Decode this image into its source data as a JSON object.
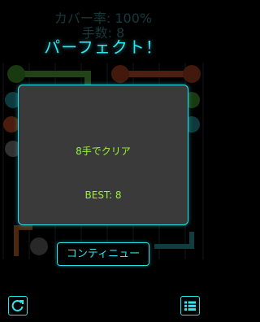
{
  "hud": {
    "coverage": "カバー率: 100%",
    "moves": "手数: 8"
  },
  "title": "パーフェクト！",
  "dialog": {
    "moves_result": "8手でクリア",
    "best": "BEST: 8"
  },
  "continue_label": "コンティニュー",
  "colors": {
    "accent": "#26e0e8",
    "result_text": "#9cf23c",
    "dialog_bg": "#3a3a3a"
  },
  "icons": {
    "restart": "restart-icon",
    "menu": "list-menu-icon"
  }
}
